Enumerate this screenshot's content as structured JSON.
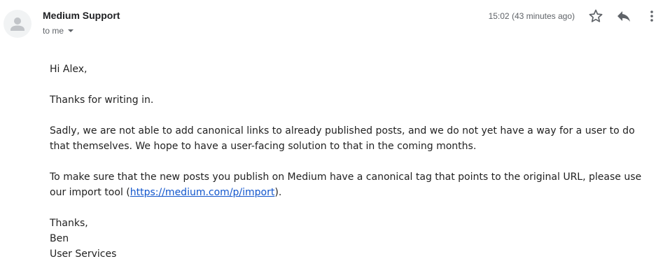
{
  "email": {
    "sender": "Medium Support",
    "recipient": "to me",
    "timestamp": "15:02 (43 minutes ago)",
    "icons": {
      "avatar": "person-icon",
      "star": "star-icon",
      "reply": "reply-icon",
      "more": "more-vertical-icon"
    },
    "body": {
      "greeting": "Hi Alex,",
      "para1": "Thanks for writing in.",
      "para2": "Sadly, we are not able to add canonical links to already published posts, and we do not yet have a way for a user to do that themselves. We hope to have a user-facing solution to that in the coming months.",
      "para3_before": "To make sure that the new posts you publish on Medium have a canonical tag that points to the original URL, please use our import tool (",
      "para3_link": "https://medium.com/p/import",
      "para3_after": ").",
      "signoff": "Thanks,",
      "name": "Ben",
      "team": "User Services"
    }
  }
}
